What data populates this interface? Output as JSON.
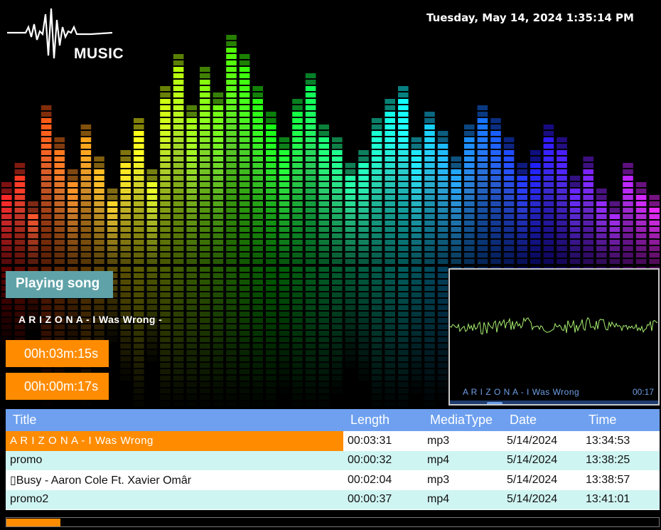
{
  "app": {
    "logo_text": "MUSIC",
    "datetime": "Tuesday, May 14, 2024 1:35:14 PM"
  },
  "player": {
    "playing_label": "Playing song",
    "current_song": "A R I Z O N A - I Was Wrong -",
    "total_time": "00h:03m:15s",
    "elapsed_time": "00h:00m:17s",
    "waveform_title": "A R I Z O N A - I Was Wrong",
    "waveform_time": "00:17",
    "progress_fraction": 0.083
  },
  "playlist": {
    "columns": [
      "Title",
      "Length",
      "MediaType",
      "Date",
      "Time"
    ],
    "rows": [
      {
        "title": "A R I Z O N A - I Was Wrong",
        "length": "00:03:31",
        "media": "mp3",
        "date": "5/14/2024",
        "time": "13:34:53"
      },
      {
        "title": "promo",
        "length": "00:00:32",
        "media": "mp4",
        "date": "5/14/2024",
        "time": "13:38:25"
      },
      {
        "title": "▯Busy - Aaron Cole Ft. Xavier Omâr",
        "length": "00:02:04",
        "media": "mp3",
        "date": "5/14/2024",
        "time": "13:38:57"
      },
      {
        "title": "promo2",
        "length": "00:00:37",
        "media": "mp4",
        "date": "5/14/2024",
        "time": "13:41:01"
      }
    ]
  },
  "colors": {
    "accent_orange": "#ff8c00",
    "header_blue": "#6ea0ef",
    "row_alt": "#cff5f2",
    "playing_label_bg": "#5fa3a8",
    "waveform_line": "#a8f070",
    "waveform_text": "#6e9fe6"
  },
  "icons": [
    "waveform-logo-icon"
  ]
}
